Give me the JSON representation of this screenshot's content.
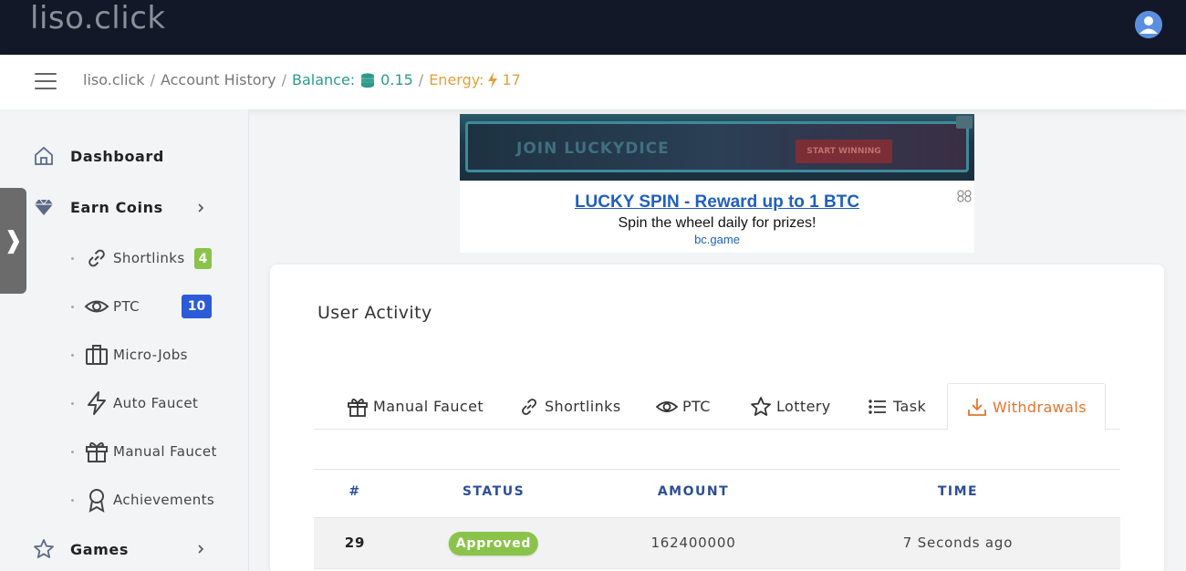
{
  "app": {
    "logo": "liso.click"
  },
  "breadcrumb": {
    "site": "liso.click",
    "page": "Account History",
    "balance_label": "Balance:",
    "balance_value": "0.15",
    "energy_label": "Energy:",
    "energy_value": "17",
    "sep": "/"
  },
  "sidebar": {
    "toggle": "❱",
    "dashboard": "Dashboard",
    "earn_coins": "Earn Coins",
    "shortlinks": "Shortlinks",
    "shortlinks_badge": "4",
    "ptc": "PTC",
    "ptc_badge": "10",
    "microjobs": "Micro-Jobs",
    "auto_faucet": "Auto Faucet",
    "manual_faucet": "Manual Faucet",
    "achievements": "Achievements",
    "games": "Games"
  },
  "ad": {
    "banner_text": "JOIN LUCKYDICE",
    "banner_button": "START WINNING",
    "title": "LUCKY SPIN - Reward up to 1 BTC",
    "description": "Spin the wheel daily for prizes!",
    "url": "bc.game"
  },
  "activity": {
    "title": "User Activity",
    "tabs": {
      "manual_faucet": "Manual Faucet",
      "shortlinks": "Shortlinks",
      "ptc": "PTC",
      "lottery": "Lottery",
      "task": "Task",
      "withdrawals": "Withdrawals"
    },
    "columns": {
      "num": "#",
      "status": "STATUS",
      "amount": "AMOUNT",
      "time": "TIME"
    },
    "rows": [
      {
        "num": "29",
        "status": "Approved",
        "amount": "162400000",
        "time": "7 Seconds ago"
      }
    ]
  },
  "colors": {
    "topbar": "#121827",
    "accent_teal": "#2b9a8a",
    "accent_orange": "#e4742f",
    "energy": "#e0a040",
    "badge_green": "#8bc34a",
    "badge_blue": "#2b5bd7",
    "header_blue": "#2c4f96"
  }
}
